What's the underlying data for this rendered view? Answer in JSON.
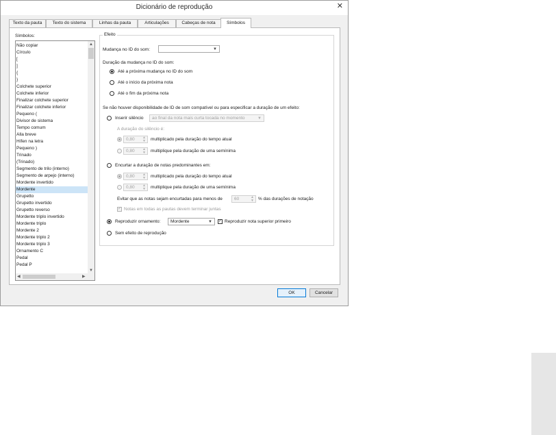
{
  "window": {
    "title": "Dicionário de reprodução"
  },
  "tabs": [
    {
      "label": "Texto da pauta"
    },
    {
      "label": "Texto do sistema"
    },
    {
      "label": "Linhas da pauta"
    },
    {
      "label": "Articulações"
    },
    {
      "label": "Cabeças de nota"
    },
    {
      "label": "Símbolos"
    }
  ],
  "symbols": {
    "label": "Símbolos:",
    "items": [
      "Não copiar",
      "Círculo",
      "[",
      "]",
      "{",
      "}",
      "Colchete superior",
      "Colchete inferior",
      "Finalizar colchete superior",
      "Finalizar colchete inferior",
      "Pequeno (",
      "Divisor de sistema",
      "Tempo comum",
      "Alla breve",
      "Hífen na letra",
      "Pequeno )",
      "Trinado",
      "(Trinado)",
      "Segmento de trilo (interno)",
      "Segmento de arpejo (interno)",
      "Mordente invertido",
      "Mordente",
      "Grupetto",
      "Grupetto invertido",
      "Grupetto reverso",
      "Mordente triplo invertido",
      "Mordente triplo",
      "Mordente 2",
      "Mordente triplo 2",
      "Mordente triplo 3",
      "Ornamento C",
      "Pedal",
      "Pedal P"
    ],
    "selected_index": 21
  },
  "effect": {
    "legend": "Efeito",
    "sound_id_label": "Mudança no ID do som:",
    "sound_id_value": "",
    "duration_label": "Duração da mudança no ID do som:",
    "duration_options": [
      "Até a próxima mudança no ID do som",
      "Até o início da próxima nota",
      "Até o fim da próxima nota"
    ],
    "duration_selected": 0,
    "fallback_label": "Se não houver disponibilidade de ID de som compatível ou para especificar a duração de um efeito:",
    "silence": {
      "label": "Inserir silêncio",
      "combo_value": "ao final da nota mais curta tocada no momento",
      "duration_label": "A duração do silêncio é:",
      "option1_value": "0,80",
      "option1_label": "multiplicado pela duração do tempo atual",
      "option2_value": "0,80",
      "option2_label": "multiplique pela duração de uma semínima"
    },
    "shorten": {
      "label": "Encurtar a duração de notas predominantes em:",
      "option1_value": "0,80",
      "option1_label": "multiplicado pela duração do tempo atual",
      "option2_value": "0,80",
      "option2_label": "multiplique pela duração de uma semínima",
      "avoid_prefix": "Evitar que as notas sejam encurtadas para menos de",
      "avoid_value": "60",
      "avoid_suffix": "% das durações de notação",
      "staves_label": "Notas em todas as pautas devem terminar juntas"
    },
    "ornament": {
      "label": "Reproduzir ornamento:",
      "value": "Mordente",
      "upper_note_label": "Reproduzir nota superior primeiro"
    },
    "no_effect_label": "Sem efeito de reprodução"
  },
  "buttons": {
    "ok": "OK",
    "cancel": "Cancelar"
  }
}
